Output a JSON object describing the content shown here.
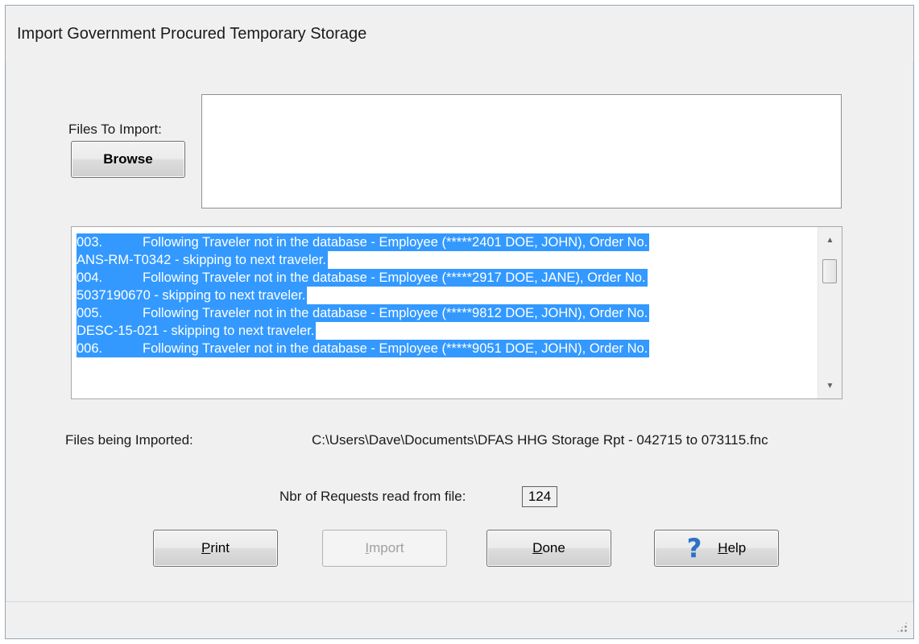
{
  "window": {
    "title": "Import Government Procured Temporary Storage"
  },
  "files_to_import": {
    "label": "Files To Import:",
    "browse_label": "Browse",
    "value": ""
  },
  "log": {
    "lines": [
      {
        "num": "003.",
        "text": "Following Traveler not in the database - Employee (*****2401 DOE, JOHN), Order No."
      },
      {
        "num": "",
        "text": "ANS-RM-T0342 - skipping to next traveler."
      },
      {
        "num": "004.",
        "text": "Following Traveler not in the database - Employee (*****2917 DOE, JANE), Order No."
      },
      {
        "num": "",
        "text": "5037190670 - skipping to next traveler."
      },
      {
        "num": "005.",
        "text": "Following Traveler not in the database - Employee (*****9812 DOE, JOHN), Order No."
      },
      {
        "num": "",
        "text": "DESC-15-021 - skipping to next traveler."
      },
      {
        "num": "006.",
        "text": "Following Traveler not in the database - Employee (*****9051 DOE, JOHN), Order No."
      }
    ]
  },
  "files_being_imported": {
    "label": "Files being Imported:",
    "value": "C:\\Users\\Dave\\Documents\\DFAS HHG Storage Rpt - 042715 to 073115.fnc"
  },
  "requests": {
    "label": "Nbr of Requests read from file:",
    "value": "124"
  },
  "buttons": {
    "print": {
      "accel": "P",
      "rest": "rint"
    },
    "import": {
      "accel": "I",
      "rest": "mport"
    },
    "done": {
      "accel": "D",
      "rest": "one"
    },
    "help": {
      "accel": "H",
      "rest": "elp",
      "icon": "?"
    }
  },
  "colors": {
    "selection": "#3399ff",
    "help_icon": "#2f6fc4"
  }
}
